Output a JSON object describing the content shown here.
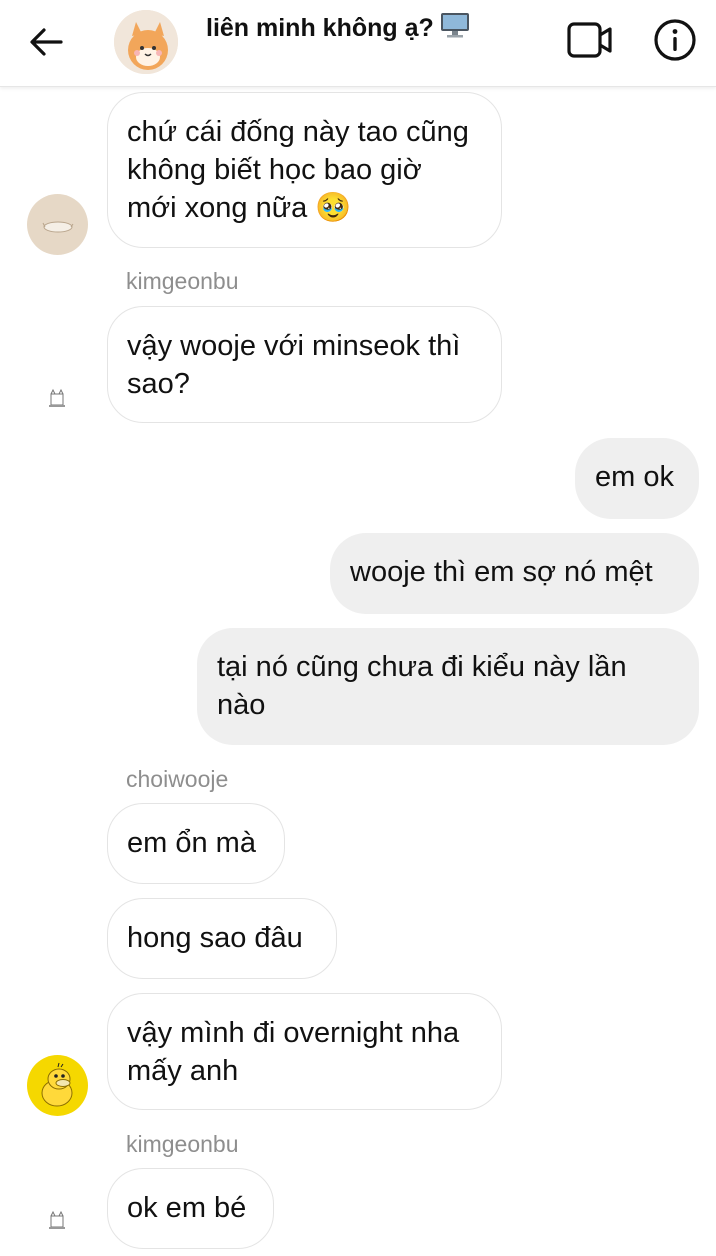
{
  "header": {
    "title": "liên minh không ạ?",
    "title_emoji": "desktop-computer-icon",
    "back_icon": "back-arrow-icon",
    "video_icon": "video-call-icon",
    "info_icon": "info-icon"
  },
  "messages": [
    {
      "sender": "",
      "direction": "in",
      "text": "chứ cái đống này tao cũng không biết học bao giờ mới xong nữa 🥹"
    },
    {
      "sender": "kimgeonbu",
      "direction": "in",
      "text": "vậy wooje với minseok thì sao?"
    },
    {
      "sender": "",
      "direction": "out",
      "text": "em ok"
    },
    {
      "sender": "",
      "direction": "out",
      "text": "wooje thì em sợ nó mệt"
    },
    {
      "sender": "",
      "direction": "out",
      "text": "tại nó cũng chưa đi kiểu này lần nào"
    },
    {
      "sender": "choiwooje",
      "direction": "in",
      "text": "em ổn mà"
    },
    {
      "sender": "",
      "direction": "in",
      "text": "hong sao đâu"
    },
    {
      "sender": "",
      "direction": "in",
      "text": "vậy mình đi overnight nha mấy anh"
    },
    {
      "sender": "kimgeonbu",
      "direction": "in",
      "text": "ok em bé"
    }
  ],
  "colors": {
    "incoming_bg": "#ffffff",
    "incoming_border": "#e4e4e4",
    "outgoing_bg": "#efefef",
    "username": "#8e8e8e"
  }
}
